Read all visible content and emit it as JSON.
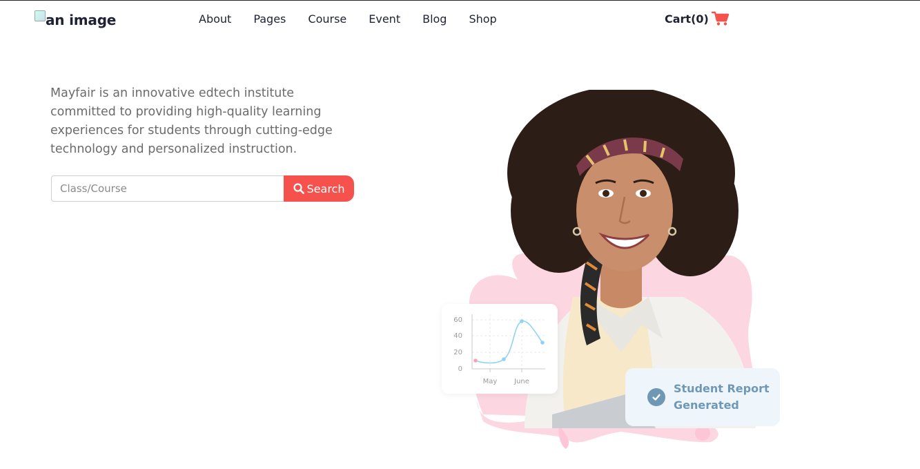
{
  "header": {
    "logo_alt": "an image",
    "nav": [
      {
        "label": "About"
      },
      {
        "label": "Pages"
      },
      {
        "label": "Course"
      },
      {
        "label": "Event"
      },
      {
        "label": "Blog"
      },
      {
        "label": "Shop"
      }
    ],
    "cart_label": "Cart(0)",
    "cart_icon": "shopping-cart-icon"
  },
  "hero": {
    "description": "Mayfair is an innovative edtech institute committed to providing high-quality learning experiences for students through cutting-edge technology and personalized instruction.",
    "search_placeholder": "Class/Course",
    "search_value": "",
    "search_button_label": "Search",
    "search_icon": "search-icon"
  },
  "illustration": {
    "chart": {
      "y_ticks": [
        "60",
        "40",
        "20",
        "0"
      ],
      "x_ticks": [
        "May",
        "June"
      ]
    },
    "report_card": {
      "text": "Student Report Generated",
      "icon": "check-circle-icon"
    }
  },
  "colors": {
    "accent": "#f5514d",
    "report_blue": "#6f98b4",
    "report_bg": "#eef6fc",
    "blob_pink": "#fcc6d6",
    "chart_line": "#8fd3f4"
  }
}
